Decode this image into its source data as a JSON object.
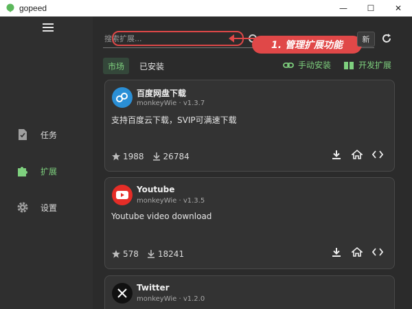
{
  "window": {
    "title": "gopeed",
    "minimize": "—",
    "maximize": "☐",
    "close": "✕"
  },
  "sidebar": {
    "items": [
      {
        "label": "任务",
        "icon": "task-file-icon"
      },
      {
        "label": "扩展",
        "icon": "puzzle-icon",
        "active": true
      },
      {
        "label": "设置",
        "icon": "gear-icon"
      }
    ]
  },
  "search": {
    "placeholder": "搜索扩展...",
    "refresh_label": "新"
  },
  "annotation": {
    "text": "1. 管理扩展功能"
  },
  "tabs": [
    {
      "label": "市场",
      "active": true
    },
    {
      "label": "已安装"
    }
  ],
  "actions": {
    "manual_install": "手动安装",
    "develop": "开发扩展"
  },
  "extensions": [
    {
      "name": "百度网盘下载",
      "author_version": "monkeyWie · v1.3.7",
      "description": "支持百度云下载，SVIP可满速下载",
      "stars": "1988",
      "downloads": "26784"
    },
    {
      "name": "Youtube",
      "author_version": "monkeyWie · v1.3.5",
      "description": "Youtube video download",
      "stars": "578",
      "downloads": "18241"
    },
    {
      "name": "Twitter",
      "author_version": "monkeyWie · v1.2.0"
    }
  ],
  "colors": {
    "accent": "#7ed07e",
    "annotation": "#e04848",
    "background": "#2b2b2b",
    "sidebar": "#2f2f2f",
    "card": "#333333"
  }
}
